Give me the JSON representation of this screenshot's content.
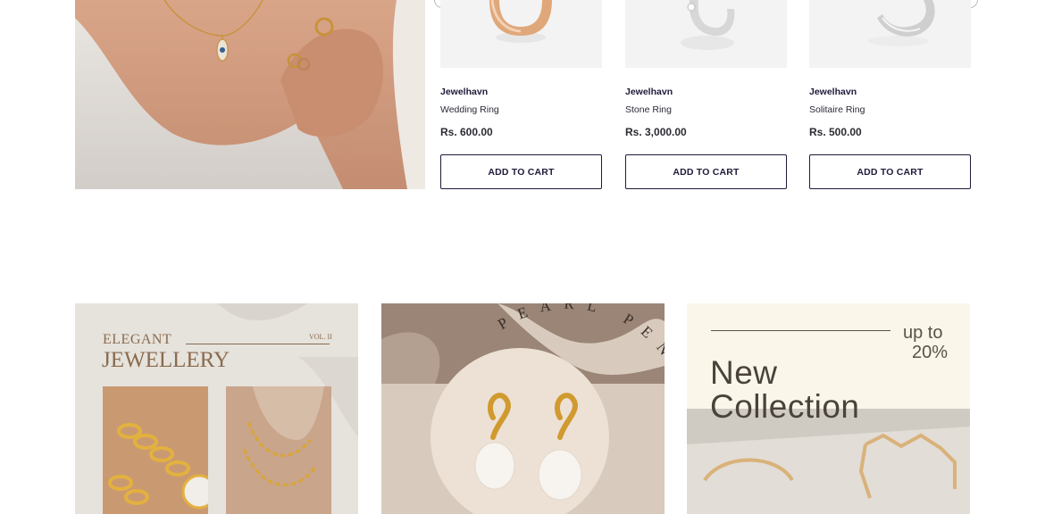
{
  "products": [
    {
      "brand": "Jewelhavn",
      "name": "Wedding Ring",
      "price": "Rs. 600.00",
      "button": "ADD TO CART",
      "image": "gold-ring"
    },
    {
      "brand": "Jewelhavn",
      "name": "Stone Ring",
      "price": "Rs. 3,000.00",
      "button": "ADD TO CART",
      "image": "silver-stone-ring"
    },
    {
      "brand": "Jewelhavn",
      "name": "Solitaire Ring",
      "price": "Rs. 500.00",
      "button": "ADD TO CART",
      "image": "silver-band-ring"
    }
  ],
  "banners": {
    "elegant": {
      "line1": "ELEGANT",
      "line2": "JEWELLERY",
      "vol": "VOL. II"
    },
    "pearl": {
      "text": "PEARL PENDANT"
    },
    "collection": {
      "promo_line1": "up to",
      "promo_line2": "20%",
      "title_line1": "New",
      "title_line2": "Collection"
    }
  },
  "colors": {
    "primary": "#1e1b3a",
    "card_bg": "#f3f3f3",
    "gold": "#c9923a"
  }
}
